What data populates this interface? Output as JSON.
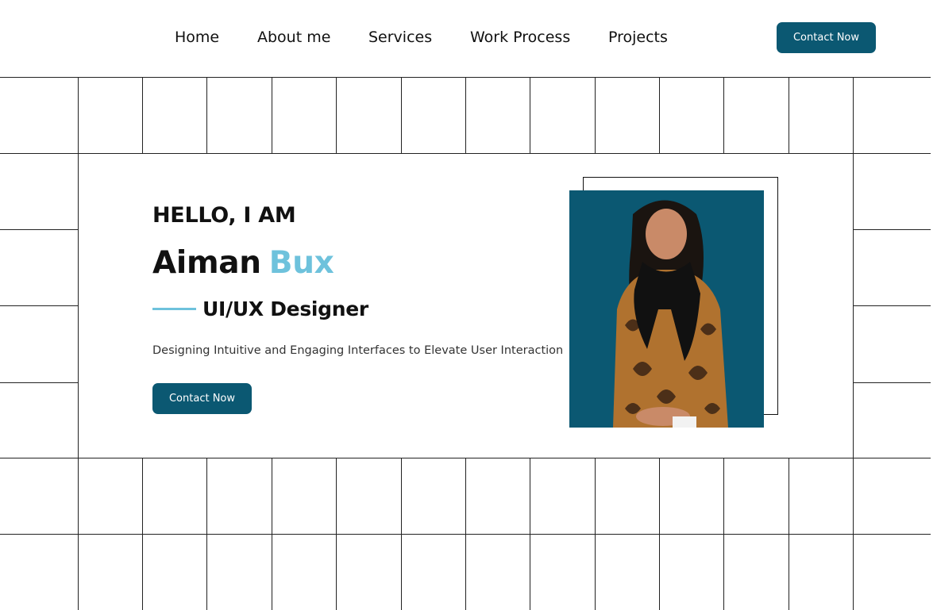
{
  "nav": {
    "items": [
      {
        "label": "Home"
      },
      {
        "label": "About me"
      },
      {
        "label": "Services"
      },
      {
        "label": "Work Process"
      },
      {
        "label": "Projects"
      }
    ],
    "cta_label": "Contact Now"
  },
  "hero": {
    "greeting": "HELLO, I AM",
    "first_name": "Aiman",
    "last_name": "Bux",
    "role": "UI/UX Designer",
    "tagline": "Designing Intuitive and Engaging Interfaces to Elevate User Interaction",
    "cta_label": "Contact Now",
    "photo_icon": "person-portrait"
  },
  "colors": {
    "primary": "#0b5872",
    "accent": "#6ec2dc",
    "text": "#111111",
    "grid_line": "#222222"
  }
}
